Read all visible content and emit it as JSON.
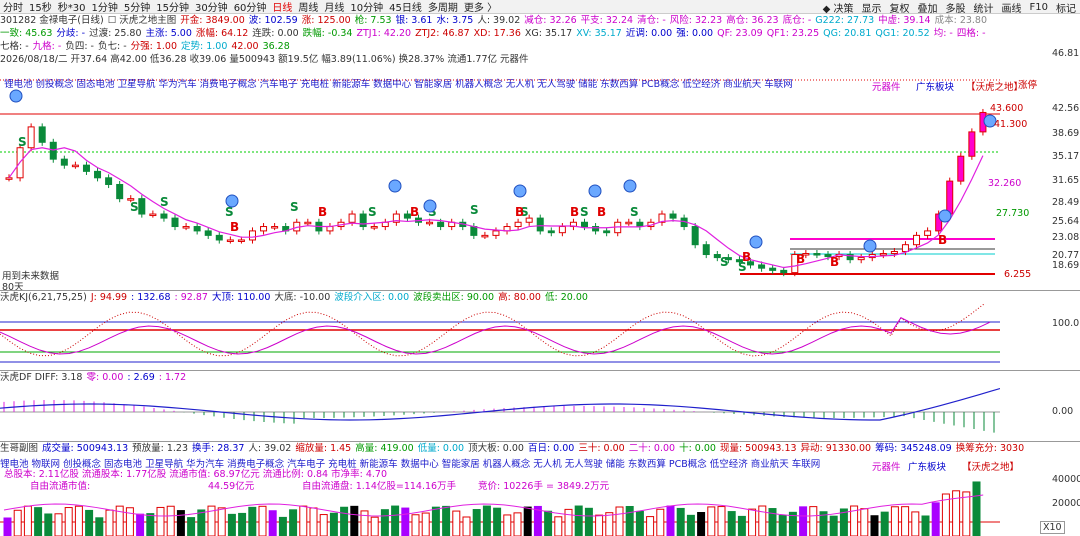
{
  "toolbar": {
    "periods": [
      "分时",
      "15秒",
      "秒*30",
      "1分钟",
      "5分钟",
      "15分钟",
      "30分钟",
      "60分钟",
      "日线",
      "周线",
      "月线",
      "10分钟",
      "45日线",
      "多周期",
      "更多 〉"
    ],
    "active": "日线",
    "right": [
      "决策",
      "显示",
      "复权",
      "叠加",
      "多股",
      "统计",
      "画线",
      "F10",
      "标记"
    ]
  },
  "main_header": {
    "row1": [
      {
        "t": "301282 金禄电子(日线)",
        "c": "#333"
      },
      {
        "t": "☐ 沃虎之地主图",
        "c": "#333"
      },
      {
        "t": "开金: 3849.00",
        "c": "#cc0000"
      },
      {
        "t": "波: 102.59",
        "c": "#0000cc"
      },
      {
        "t": "涨: 125.00",
        "c": "#cc0000"
      },
      {
        "t": "枪: 7.53",
        "c": "#009900"
      },
      {
        "t": "银: 3.61",
        "c": "#0000cc"
      },
      {
        "t": "水: 3.75",
        "c": "#0000cc"
      },
      {
        "t": "人: 39.02",
        "c": "#333"
      },
      {
        "t": "减仓: 32.26",
        "c": "#cc00cc"
      },
      {
        "t": "平支: 32.24",
        "c": "#cc00cc"
      },
      {
        "t": "清仓: -",
        "c": "#cc00cc"
      },
      {
        "t": "风险: 32.23",
        "c": "#cc00cc"
      },
      {
        "t": "高仓: 36.23",
        "c": "#cc00cc"
      },
      {
        "t": "底仓: -",
        "c": "#cc00cc"
      },
      {
        "t": "G222: 27.73",
        "c": "#00aacc"
      },
      {
        "t": "中虚: 39.14",
        "c": "#cc00cc"
      },
      {
        "t": "成本: 23.80",
        "c": "#888"
      }
    ],
    "row2": [
      {
        "t": "一致: 45.63",
        "c": "#009900"
      },
      {
        "t": "分歧: -",
        "c": "#0000cc"
      },
      {
        "t": "过渡: 25.80",
        "c": "#333"
      },
      {
        "t": "主涨: 5.00",
        "c": "#0000cc"
      },
      {
        "t": "涨幅: 64.12",
        "c": "#cc0000"
      },
      {
        "t": "连跌: 0.00",
        "c": "#333"
      },
      {
        "t": "跌幅: -0.34",
        "c": "#009900"
      },
      {
        "t": "ZTJ1: 42.20",
        "c": "#cc00cc"
      },
      {
        "t": "ZTJ2: 46.87",
        "c": "#cc0000"
      },
      {
        "t": "XD: 17.36",
        "c": "#cc0000"
      },
      {
        "t": "XG: 35.17",
        "c": "#333"
      },
      {
        "t": "XV: 35.17",
        "c": "#00aacc"
      },
      {
        "t": "近调: 0.00",
        "c": "#0000cc"
      },
      {
        "t": "强: 0.00",
        "c": "#0000cc"
      },
      {
        "t": "QF: 23.09",
        "c": "#cc00cc"
      },
      {
        "t": "QF1: 23.25",
        "c": "#cc00cc"
      },
      {
        "t": "QG: 20.81",
        "c": "#00aacc"
      },
      {
        "t": "QG1: 20.52",
        "c": "#00aacc"
      },
      {
        "t": "均: -",
        "c": "#cc00cc"
      },
      {
        "t": "四格: -",
        "c": "#cc00cc"
      }
    ],
    "row3": [
      {
        "t": "七格: -",
        "c": "#333"
      },
      {
        "t": "九格: -",
        "c": "#cc00cc"
      },
      {
        "t": "负四: -",
        "c": "#333"
      },
      {
        "t": "负七: -",
        "c": "#333"
      },
      {
        "t": "分强: 1.00",
        "c": "#cc0000"
      },
      {
        "t": "定势: 1.00",
        "c": "#00aacc"
      },
      {
        "t": "42.00",
        "c": "#cc0000"
      },
      {
        "t": "36.28",
        "c": "#009900"
      }
    ],
    "row4": "2026/08/18/二 开37.64 高42.00 低36.28 收39.06 量500943 额19.5亿 幅3.89(11.06%) 换28.37% 流通1.77亿 元器件",
    "concepts": "锂电池 创投概念 固态电池 卫星导航 华为汽车 消费电子概念 汽车电子 充电桩 新能源车 数据中心 智能家居 机器人概念 无人机 无人驾驶 储能 东数西算 PCB概念 低空经济 商业航天 车联网",
    "sector1": "元器件",
    "sector2": "广东板块",
    "sector3": "【沃虎之地】",
    "note_future": "用到未来数据",
    "note_days": "80天",
    "price_labels": [
      "43.600",
      "41.300",
      "32.260",
      "27.730",
      "6.255"
    ],
    "right_tag": "涨停"
  },
  "main_axis": [
    "46.81",
    "42.56",
    "38.69",
    "35.17",
    "31.65",
    "28.49",
    "25.64",
    "23.08",
    "20.77",
    "18.69"
  ],
  "kj": {
    "hdr": [
      {
        "t": "沃虎KJ(6,21,75,25)",
        "c": "#333"
      },
      {
        "t": "J: 94.99",
        "c": "#cc0000"
      },
      {
        "t": ": 132.68",
        "c": "#0000cc"
      },
      {
        "t": ": 92.87",
        "c": "#cc00cc"
      },
      {
        "t": "大顶: 110.00",
        "c": "#0000cc"
      },
      {
        "t": "大底: -10.00",
        "c": "#333"
      },
      {
        "t": "波段介入区: 0.00",
        "c": "#00aacc"
      },
      {
        "t": "波段卖出区: 90.00",
        "c": "#009900"
      },
      {
        "t": "高: 80.00",
        "c": "#cc0000"
      },
      {
        "t": "低: 20.00",
        "c": "#009900"
      }
    ],
    "axis": [
      "100.0"
    ]
  },
  "df": {
    "hdr": [
      {
        "t": "沃虎DF DIFF: 3.18",
        "c": "#333"
      },
      {
        "t": "零: 0.00",
        "c": "#cc00cc"
      },
      {
        "t": ": 2.69",
        "c": "#0000cc"
      },
      {
        "t": ": 1.72",
        "c": "#cc00cc"
      }
    ],
    "axis": [
      "0.00"
    ]
  },
  "vol": {
    "hdr": [
      {
        "t": "生哥副图",
        "c": "#333"
      },
      {
        "t": "成交量: 500943.13",
        "c": "#0000cc"
      },
      {
        "t": "预放量: 1.23",
        "c": "#333"
      },
      {
        "t": "换手: 28.37",
        "c": "#0000cc"
      },
      {
        "t": "人: 39.02",
        "c": "#333"
      },
      {
        "t": "缩放量: 1.45",
        "c": "#cc0000"
      },
      {
        "t": "高量: 419.00",
        "c": "#009900"
      },
      {
        "t": "低量: 0.00",
        "c": "#00aacc"
      },
      {
        "t": "顶大板: 0.00",
        "c": "#333"
      },
      {
        "t": "百日: 0.00",
        "c": "#0000cc"
      },
      {
        "t": "三十: 0.00",
        "c": "#cc0000"
      },
      {
        "t": "二十: 0.00",
        "c": "#cc00cc"
      },
      {
        "t": "十: 0.00",
        "c": "#009900"
      },
      {
        "t": "现量: 500943.13",
        "c": "#cc0000"
      },
      {
        "t": "异动: 91330.00",
        "c": "#cc0000"
      },
      {
        "t": "筹码: 345248.09",
        "c": "#0000cc"
      },
      {
        "t": "换筹充分: 3030",
        "c": "#cc0000"
      }
    ],
    "concepts": "锂电池 物联网 创投概念 固态电池 卫星导航 华为汽车 消费电子概念 汽车电子 充电桩 新能源车 数据中心 智能家居 机器人概念 无人机 无人驾驶 储能 东数西算 PCB概念 低空经济 商业航天 车联网",
    "row2": "总股本: 2.11亿股     流通股本: 1.77亿股     流通市值: 68.97亿元       流通比例: 0.84       市净率: 4.70",
    "row3a": "自由流通市值:",
    "row3b": "44.59亿元",
    "row3c": "自由流通盘: 1.14亿股=114.16万手",
    "row3d": "竞价: 10226手 = 3849.2万元",
    "axis": [
      "40000",
      "20000"
    ],
    "x10": "X10"
  },
  "colors": {
    "up": "#e00000",
    "down": "#0a8a3a",
    "ma": "#e020e0",
    "magenta": "#ff00cc"
  }
}
